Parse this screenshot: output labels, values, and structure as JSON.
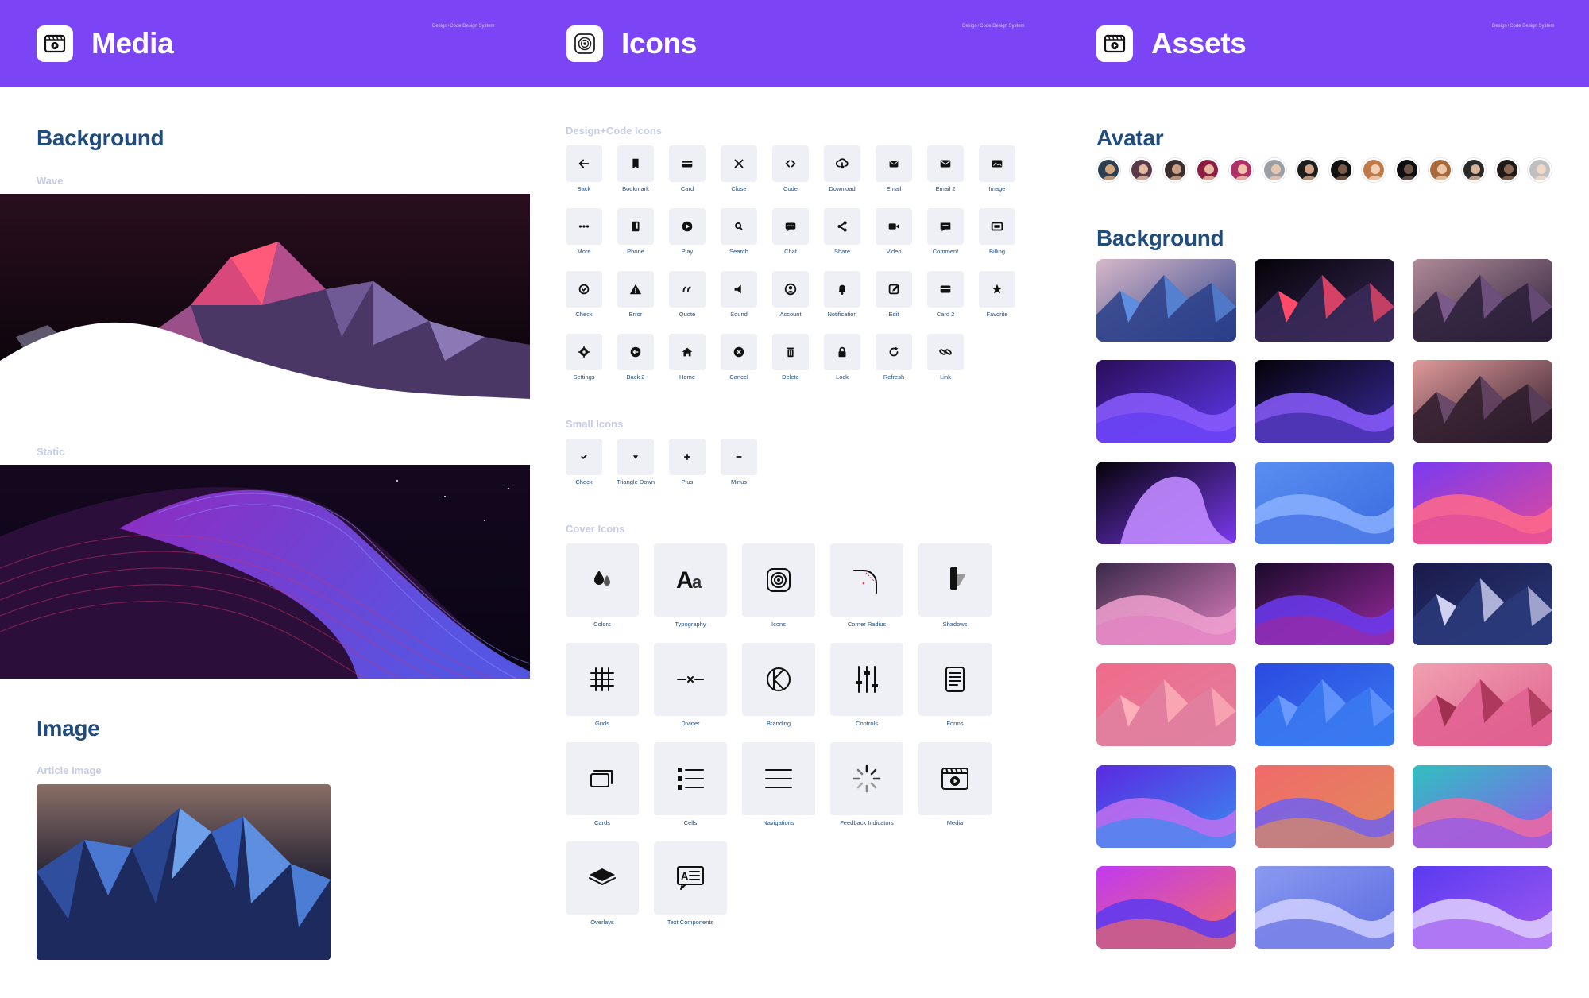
{
  "header": {
    "columns": [
      {
        "title": "Media",
        "tagline": "Design+Code Design System",
        "icon": "media-player-icon"
      },
      {
        "title": "Icons",
        "tagline": "Design+Code Design System",
        "icon": "icons-target-icon"
      },
      {
        "title": "Assets",
        "tagline": "Design+Code Design System",
        "icon": "media-player-icon"
      }
    ]
  },
  "media": {
    "background_title": "Background",
    "wave_label": "Wave",
    "static_label": "Static",
    "image_title": "Image",
    "article_label": "Article Image"
  },
  "icons": {
    "design_code_label": "Design+Code Icons",
    "design_code_icons": [
      "Back",
      "Bookmark",
      "Card",
      "Close",
      "Code",
      "Download",
      "Email",
      "Email 2",
      "Image",
      "More",
      "Phone",
      "Play",
      "Search",
      "Chat",
      "Share",
      "Video",
      "Comment",
      "Billing",
      "Check",
      "Error",
      "Quote",
      "Sound",
      "Account",
      "Notification",
      "Edit",
      "Card 2",
      "Favorite",
      "Settings",
      "Back 2",
      "Home",
      "Cancel",
      "Delete",
      "Lock",
      "Refresh",
      "Link"
    ],
    "small_label": "Small Icons",
    "small_icons": [
      "Check",
      "Triangle Down",
      "Plus",
      "Minus"
    ],
    "cover_label": "Cover Icons",
    "cover_icons": [
      "Colors",
      "Typography",
      "Icons",
      "Corner Radius",
      "Shadows",
      "Grids",
      "Divider",
      "Branding",
      "Controls",
      "Forms",
      "Cards",
      "Cells",
      "Navigations",
      "Feedback Indicators",
      "Media",
      "Overlays",
      "Text Components"
    ]
  },
  "assets": {
    "avatar_title": "Avatar",
    "avatar_count": 14,
    "background_title": "Background",
    "thumbnail_count": 21
  },
  "colors": {
    "header_purple": "#7B44F5",
    "title_blue": "#1F4C7D",
    "label_muted": "#C7CCE6",
    "tile_bg": "#EEF0F6"
  }
}
